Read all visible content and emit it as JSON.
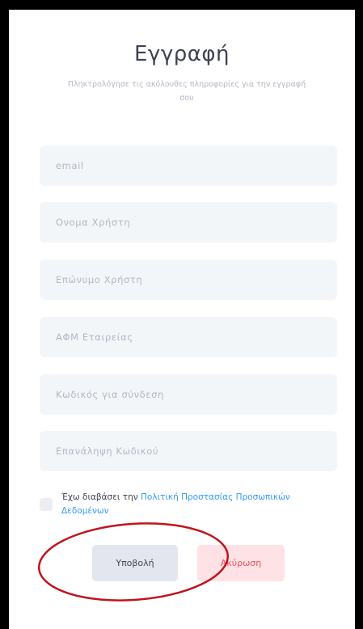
{
  "form": {
    "title": "Εγγραφή",
    "subtitle": "Πληκτρολόγησε τις ακόλουθες πληροφορίες για την εγγραφή σου",
    "fields": [
      {
        "placeholder": "email",
        "value": ""
      },
      {
        "placeholder": "Ονομα Χρήστη",
        "value": ""
      },
      {
        "placeholder": "Επώνυμο Χρήστη",
        "value": ""
      },
      {
        "placeholder": "ΑΦΜ Εταιρείας",
        "value": ""
      },
      {
        "placeholder": "Κωδικός για σύνδεση",
        "value": ""
      },
      {
        "placeholder": "Επανάληψη Κωδικού",
        "value": ""
      }
    ],
    "consent": {
      "prefix": "Έχω διαβάσει την ",
      "link_text": "Πολιτική Προστασίας Προσωπικών Δεδομένων",
      "checked": false
    },
    "submit_label": "Υποβολή",
    "cancel_label": "Ακύρωση"
  },
  "colors": {
    "annotation": "#c0141c",
    "link": "#3699ff",
    "cancel_text": "#f64e60"
  }
}
